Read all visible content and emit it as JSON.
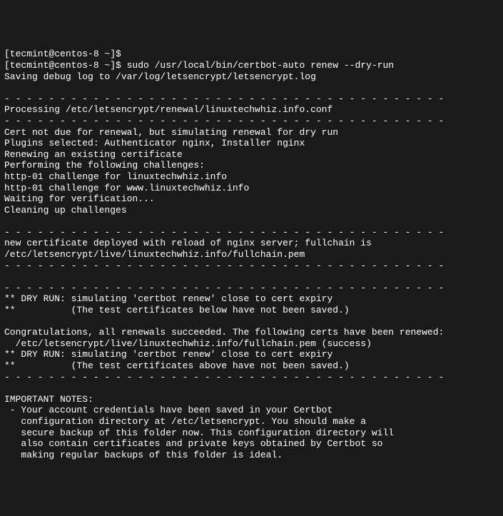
{
  "terminal": {
    "lines": [
      "[tecmint@centos-8 ~]$",
      "[tecmint@centos-8 ~]$ sudo /usr/local/bin/certbot-auto renew --dry-run",
      "Saving debug log to /var/log/letsencrypt/letsencrypt.log",
      "",
      "- - - - - - - - - - - - - - - - - - - - - - - - - - - - - - - - - - - - - - - -",
      "Processing /etc/letsencrypt/renewal/linuxtechwhiz.info.conf",
      "- - - - - - - - - - - - - - - - - - - - - - - - - - - - - - - - - - - - - - - -",
      "Cert not due for renewal, but simulating renewal for dry run",
      "Plugins selected: Authenticator nginx, Installer nginx",
      "Renewing an existing certificate",
      "Performing the following challenges:",
      "http-01 challenge for linuxtechwhiz.info",
      "http-01 challenge for www.linuxtechwhiz.info",
      "Waiting for verification...",
      "Cleaning up challenges",
      "",
      "- - - - - - - - - - - - - - - - - - - - - - - - - - - - - - - - - - - - - - - -",
      "new certificate deployed with reload of nginx server; fullchain is",
      "/etc/letsencrypt/live/linuxtechwhiz.info/fullchain.pem",
      "- - - - - - - - - - - - - - - - - - - - - - - - - - - - - - - - - - - - - - - -",
      "",
      "- - - - - - - - - - - - - - - - - - - - - - - - - - - - - - - - - - - - - - - -",
      "** DRY RUN: simulating 'certbot renew' close to cert expiry",
      "**          (The test certificates below have not been saved.)",
      "",
      "Congratulations, all renewals succeeded. The following certs have been renewed:",
      "  /etc/letsencrypt/live/linuxtechwhiz.info/fullchain.pem (success)",
      "** DRY RUN: simulating 'certbot renew' close to cert expiry",
      "**          (The test certificates above have not been saved.)",
      "- - - - - - - - - - - - - - - - - - - - - - - - - - - - - - - - - - - - - - - -",
      "",
      "IMPORTANT NOTES:",
      " - Your account credentials have been saved in your Certbot",
      "   configuration directory at /etc/letsencrypt. You should make a",
      "   secure backup of this folder now. This configuration directory will",
      "   also contain certificates and private keys obtained by Certbot so",
      "   making regular backups of this folder is ideal."
    ]
  }
}
